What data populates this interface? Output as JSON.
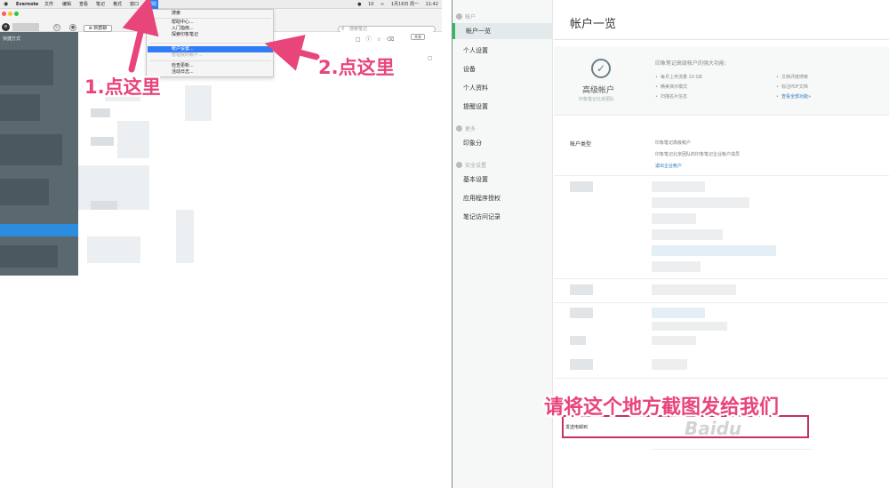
{
  "left": {
    "menubar": {
      "apple": "",
      "app_name": "Evernote",
      "items": [
        "文件",
        "编辑",
        "查看",
        "笔记",
        "格式",
        "窗口",
        "帮助"
      ],
      "status": [
        "10",
        "1月16日 周一",
        "11:42"
      ]
    },
    "toolbar": {
      "new_note": "新群聊",
      "search_placeholder": "搜索笔记"
    },
    "sidebar": {
      "shortcuts": "快捷方式"
    },
    "share_button": "共享",
    "help_menu": {
      "items": [
        "搜索",
        "帮助中心...",
        "入门指南...",
        "探索印象笔记",
        "帐户设置...",
        "管理我的帐户...",
        "检查更新...",
        "活动日志..."
      ]
    },
    "annotations": {
      "step1": "1.点这里",
      "step2": "2.点这里"
    }
  },
  "right": {
    "nav": {
      "section_account": "帐户",
      "items_account": [
        "帐户一览",
        "个人设置",
        "设备",
        "个人资料",
        "提醒设置"
      ],
      "section_more": "更多",
      "items_more": [
        "印象分"
      ],
      "section_security": "安全设置",
      "items_security": [
        "基本设置",
        "应用程序授权",
        "笔记访问记录"
      ]
    },
    "content": {
      "title": "帐户一览",
      "premium": {
        "name": "高级帐户",
        "subtitle": "印象笔记北京团队",
        "features_title": "印象笔记高级帐户的强大功能:",
        "features_left": [
          "每月上传流量 10 GB",
          "精美演示模式",
          "扫描名片信息"
        ],
        "features_right": [
          "文档评度搜索",
          "标注PDF文档",
          "查看全部功能»"
        ]
      },
      "account_type": {
        "label": "帐户类型",
        "line1": "印象笔记高级帐户",
        "line2": "印象笔记北京团队的印象笔记企业帐户成员",
        "line3": "退出企业帐户"
      },
      "send_email": "发送电邮到"
    },
    "annotation": "请将这个地方截图发给我们",
    "watermark": "Baidu"
  },
  "colors": {
    "annotation_pink": "#e8457a",
    "highlight_box": "#c62f67",
    "menu_highlight": "#2f7df6",
    "nav_active_accent": "#2dbe60"
  }
}
